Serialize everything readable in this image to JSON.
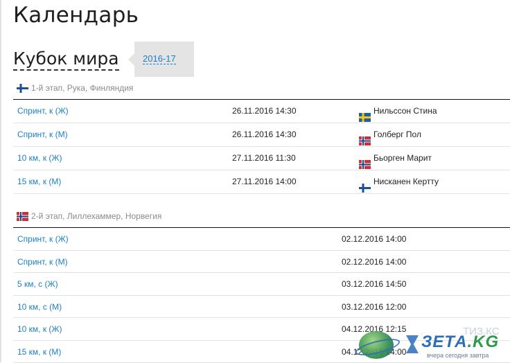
{
  "page": {
    "title": "Календарь"
  },
  "cup": {
    "title": "Кубок мира",
    "season": "2016-17"
  },
  "stages": [
    {
      "header": "1-й этап, Рука, Финляндия",
      "flag": "finland",
      "rows": [
        {
          "event": "Спринт, к (Ж)",
          "date": "26.11.2016 14:30",
          "winner": "Нильссон Стина",
          "winner_flag": "sweden"
        },
        {
          "event": "Спринт, к (М)",
          "date": "26.11.2016 14:30",
          "winner": "Голберг Пол",
          "winner_flag": "norway"
        },
        {
          "event": "10 км, к (Ж)",
          "date": "27.11.2016 11:30",
          "winner": "Бьорген Марит",
          "winner_flag": "norway"
        },
        {
          "event": "15 км, к (М)",
          "date": "27.11.2016 14:00",
          "winner": "Нисканен Кертту",
          "winner_flag": "finland"
        }
      ]
    },
    {
      "header": "2-й этап, Лиллехаммер, Норвегия",
      "flag": "norway",
      "rows": [
        {
          "event": "Спринт, к (Ж)",
          "date": "02.12.2016 14:00"
        },
        {
          "event": "Спринт, к (М)",
          "date": "02.12.2016 14:00"
        },
        {
          "event": "5 км, с (Ж)",
          "date": "03.12.2016 14:50"
        },
        {
          "event": "10 км, с (М)",
          "date": "03.12.2016 12:00"
        },
        {
          "event": "10 км, к (Ж)",
          "date": "04.12.2016 12:15"
        },
        {
          "event": "15 км, к (М)",
          "date": "04.12.2016 14:00"
        }
      ]
    }
  ],
  "watermark": {
    "brand": "ЗЕТА",
    "tld": ".KG",
    "tagline": "вчера сегодня завтра",
    "overlay": "ТИЗ.КС"
  },
  "colors": {
    "link": "#1b7fc7",
    "finland_blue": "#1a4fa0",
    "sweden_blue": "#1f5fa8",
    "sweden_yellow": "#f4c816",
    "norway_red": "#c8303a",
    "norway_blue": "#1f3f8a"
  }
}
